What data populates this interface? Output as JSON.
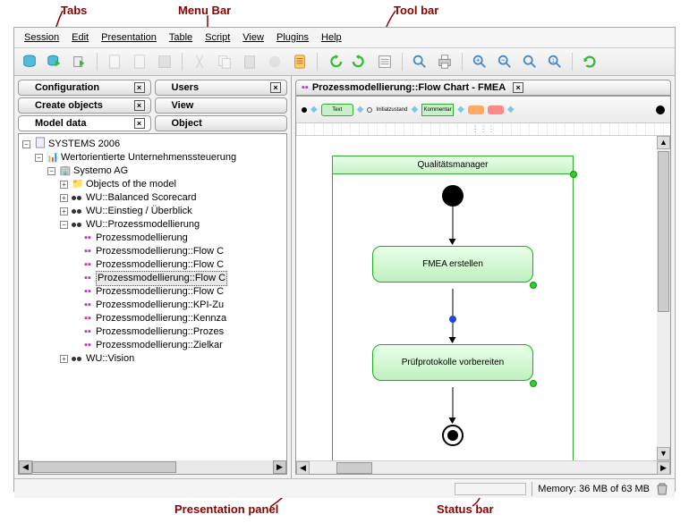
{
  "annotations": {
    "tabs": "Tabs",
    "menubar": "Menu Bar",
    "toolbar": "Tool bar",
    "presentation": "Presentation panel",
    "statusbar": "Status bar"
  },
  "menu": {
    "session": "Session",
    "edit": "Edit",
    "presentation": "Presentation",
    "table": "Table",
    "script": "Script",
    "view": "View",
    "plugins": "Plugins",
    "help": "Help"
  },
  "tabs": {
    "configuration": "Configuration",
    "users": "Users",
    "create_objects": "Create objects",
    "view": "View",
    "model_data": "Model data",
    "object": "Object"
  },
  "right_tab": {
    "title": "Prozessmodellierung::Flow Chart - FMEA"
  },
  "palette": {
    "text": "Text",
    "initial": "Initialzustand",
    "comment": "Kommentar"
  },
  "tree": {
    "root": "SYSTEMS 2006",
    "l1": "Wertorientierte Unternehmenssteuerung",
    "l2": "Systemo AG",
    "objs": "Objects of the model",
    "bs": "WU::Balanced Scorecard",
    "einstieg": "WU::Einstieg / Überblick",
    "prozess": "WU::Prozessmodellierung",
    "p1": "Prozessmodellierung",
    "p2": "Prozessmodellierung::Flow C",
    "p3": "Prozessmodellierung::Flow C",
    "p4": "Prozessmodellierung::Flow C",
    "p5": "Prozessmodellierung::Flow C",
    "p6": "Prozessmodellierung::KPI-Zu",
    "p7": "Prozessmodellierung::Kennza",
    "p8": "Prozessmodellierung::Prozes",
    "p9": "Prozessmodellierung::Zielkar",
    "vision": "WU::Vision"
  },
  "diagram": {
    "lane": "Qualitätsmanager",
    "act1": "FMEA erstellen",
    "act2": "Prüfprotokolle vorbereiten"
  },
  "status": {
    "memory": "Memory: 36 MB of 63 MB"
  }
}
